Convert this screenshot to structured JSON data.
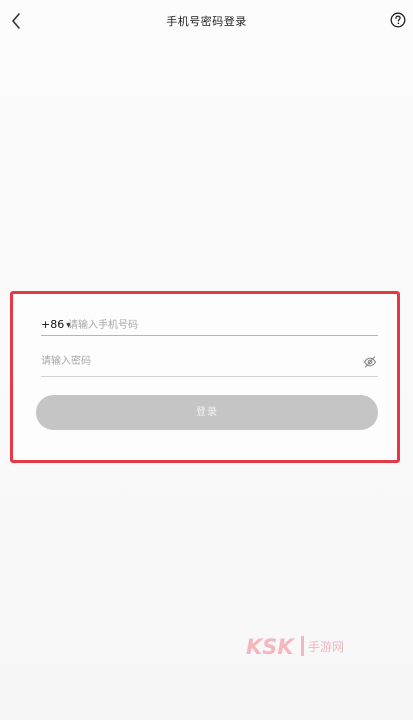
{
  "header": {
    "title": "手机号密码登录",
    "back_icon": "chevron-left-icon",
    "help_icon": "question-circle-icon"
  },
  "login_form": {
    "country_code": "+86",
    "phone_placeholder": "请输入手机号码",
    "password_placeholder": "请输入密码",
    "password_visibility_icon": "eye-off-icon",
    "login_button_label": "登录"
  },
  "watermark": {
    "logo_text": "KSK",
    "site_text": "手游网"
  },
  "colors": {
    "highlight_border": "#e53a43",
    "button_disabled": "#c5c5c5",
    "watermark": "#f3b8bf"
  }
}
